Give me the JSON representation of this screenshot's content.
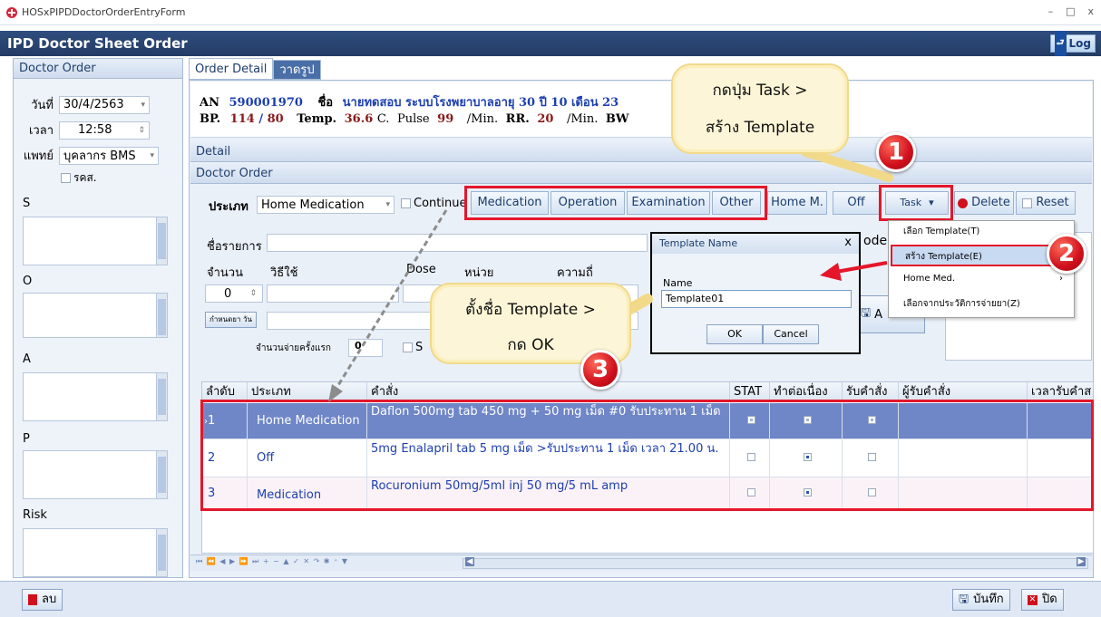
{
  "window": {
    "title": "HOSxPIPDDoctorOrderEntryForm",
    "controls": [
      "–",
      "□",
      "x"
    ]
  },
  "header": {
    "title": "IPD Doctor Sheet Order",
    "log_label": "Log"
  },
  "left_panel": {
    "title": "Doctor Order",
    "date_label": "วันที่",
    "date_value": "30/4/2563",
    "time_label": "เวลา",
    "time_value": "12:58",
    "doctor_label": "แพทย์",
    "doctor_value": "บุคลากร BMS",
    "checkbox_label": "รคส.",
    "sections": [
      "S",
      "O",
      "A",
      "P",
      "Risk"
    ]
  },
  "tabs": [
    {
      "label": "Order Detail"
    },
    {
      "label": "วาดรูป"
    }
  ],
  "patient": {
    "an_label": "AN",
    "an_value": "590001970",
    "name_label": "ชื่อ",
    "name_value": "นายทดสอบ ระบบโรงพยาบาล",
    "age_value": "อายุ 30 ปี 10 เดือน 23",
    "bp_label": "BP.",
    "bp_sys": "114",
    "bp_sep": "/",
    "bp_dia": "80",
    "temp_label": "Temp.",
    "temp_value": "36.6",
    "temp_unit": "C.",
    "pulse_label": "Pulse",
    "pulse_value": "99",
    "pulse_unit": "/Min.",
    "rr_label": "RR.",
    "rr_value": "20",
    "rr_unit": "/Min.",
    "bw_label": "BW"
  },
  "detail_bar": "Detail",
  "doctor_order_bar": "Doctor Order",
  "toolbar": {
    "type_label": "ประเภท",
    "type_value": "Home Medication",
    "continue_label": "Continue",
    "buttons": [
      "Medication",
      "Operation",
      "Examination",
      "Other",
      "Home M.",
      "Off"
    ],
    "task_label": "Task",
    "delete_label": "Delete",
    "reset_label": "Reset"
  },
  "form": {
    "item_label": "ชื่อรายการ",
    "qty_label": "จำนวน",
    "route_label": "วิธีใช้",
    "dose_label": "Dose",
    "unit_label": "หน่วย",
    "freq_label": "ความถี่",
    "qty_value": "0",
    "set_days_label": "กำหนดยา วัน",
    "first_dispense_label": "จำนวนจ่ายครั้งแรก",
    "first_dispense_value": "0",
    "s_label": "S",
    "code_label": "ode",
    "add_label": "A"
  },
  "template_dialog": {
    "title": "Template Name",
    "close": "x",
    "name_label": "Name",
    "name_value": "Template01",
    "ok_label": "OK",
    "cancel_label": "Cancel"
  },
  "task_menu": {
    "items": [
      {
        "label": "เลือก Template(T)"
      },
      {
        "label": "สร้าง Template(E)"
      },
      {
        "label": "Home Med."
      },
      {
        "label": "เลือกจากประวัติการจ่ายยา(Z)"
      }
    ]
  },
  "grid": {
    "headers": [
      "ลำดับ",
      "ประเภท",
      "คำสั่ง",
      "STAT",
      "ทำต่อเนื่อง",
      "รับคำสั่ง",
      "ผู้รับคำสั่ง",
      "เวลารับคำส"
    ],
    "rows": [
      {
        "seq": "1",
        "type": "Home Medication",
        "order": "Daflon 500mg tab 450 mg + 50 mg เม็ด    #0 รับประทาน 1 เม็ด",
        "stat": true,
        "continuous": true,
        "accepted": true
      },
      {
        "seq": "2",
        "type": "Off",
        "order": "5mg  Enalapril  tab 5 mg เม็ด >รับประทาน 1 เม็ด เวลา 21.00 น.",
        "stat": false,
        "continuous": true,
        "accepted": false
      },
      {
        "seq": "3",
        "type": "Medication",
        "order": "Rocuronium 50mg/5ml inj 50 mg/5 mL amp",
        "stat": false,
        "continuous": true,
        "accepted": false
      }
    ],
    "nav_glyphs": "⏮ ⏪ ◀ ▶ ⏩ ⏭ + − ▲ ✓ ✕ ↷ ✱ ⁺ ▼"
  },
  "bottom": {
    "delete_label": "ลบ",
    "save_label": "บันทึก",
    "close_label": "ปิด"
  },
  "callouts": {
    "c1_line1": "กดปุ่ม Task >",
    "c1_line2": "สร้าง Template",
    "c3_line1": "ตั้งชื่อ Template >",
    "c3_line2": "กด OK"
  },
  "badges": [
    "1",
    "2",
    "3"
  ],
  "colors": {
    "header_bg": "#2f4d7e",
    "annotation_red": "#e5162a",
    "selected_row": "#6f86c7",
    "callout_fill": "#fdf5d7"
  }
}
